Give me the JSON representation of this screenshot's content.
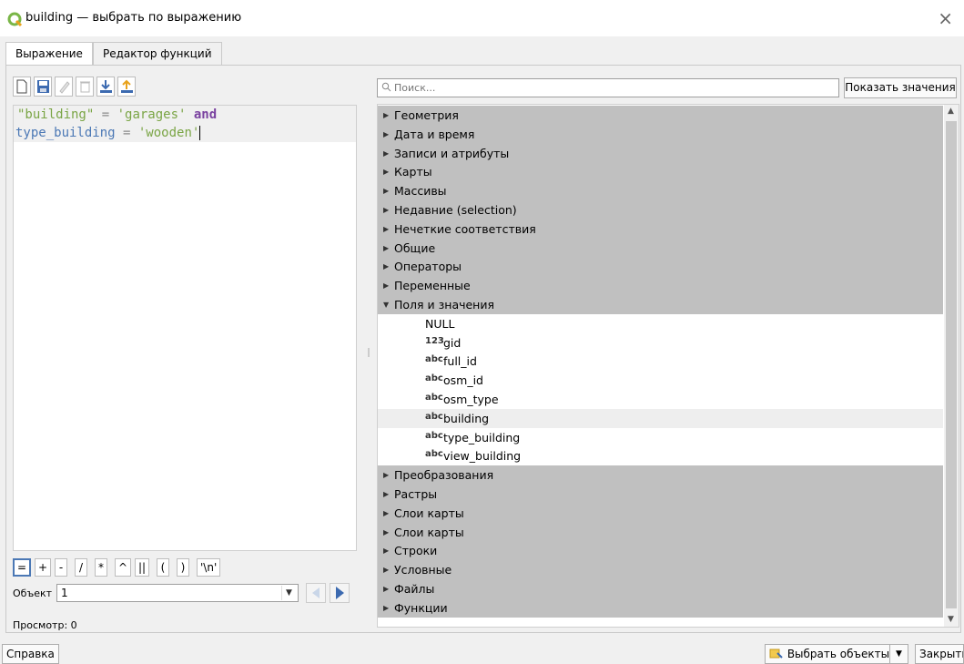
{
  "window": {
    "title": "building — выбрать по выражению"
  },
  "tabs": [
    {
      "label": "Выражение",
      "active": true
    },
    {
      "label": "Редактор функций",
      "active": false
    }
  ],
  "toolbar": {
    "icons": [
      "new-file-icon",
      "save-icon",
      "edit-icon",
      "delete-icon",
      "import-icon",
      "export-icon"
    ]
  },
  "editor": {
    "tokens_line1": [
      "\"building\"",
      " = ",
      "'garages'",
      " and"
    ],
    "tokens_line2": [
      "type_building",
      " = ",
      "'wooden'"
    ]
  },
  "operators": [
    "=",
    "+",
    "-",
    "/",
    "*",
    "^",
    "||",
    "(",
    ")",
    "'\\n'"
  ],
  "feature": {
    "label": "Объект",
    "value": "1"
  },
  "preview": {
    "text": "Просмотр: 0"
  },
  "search": {
    "placeholder": "Поиск..."
  },
  "show_values_label": "Показать значения",
  "tree": {
    "groups_before": [
      "Геометрия",
      "Дата и время",
      "Записи и атрибуты",
      "Карты",
      "Массивы",
      "Недавние (selection)",
      "Нечеткие соответствия",
      "Общие",
      "Операторы",
      "Переменные"
    ],
    "expanded_group": "Поля и значения",
    "fields": [
      {
        "type": "",
        "name": "NULL"
      },
      {
        "type": "123",
        "name": "gid"
      },
      {
        "type": "abc",
        "name": "full_id"
      },
      {
        "type": "abc",
        "name": "osm_id"
      },
      {
        "type": "abc",
        "name": "osm_type"
      },
      {
        "type": "abc",
        "name": "building",
        "highlighted": true
      },
      {
        "type": "abc",
        "name": "type_building"
      },
      {
        "type": "abc",
        "name": "view_building"
      }
    ],
    "groups_after": [
      "Преобразования",
      "Растры",
      "Слои карты",
      "Слои карты",
      "Строки",
      "Условные",
      "Файлы",
      "Функции"
    ]
  },
  "buttons": {
    "help": "Справка",
    "select_features": "Выбрать объекты",
    "close": "Закрыть"
  }
}
